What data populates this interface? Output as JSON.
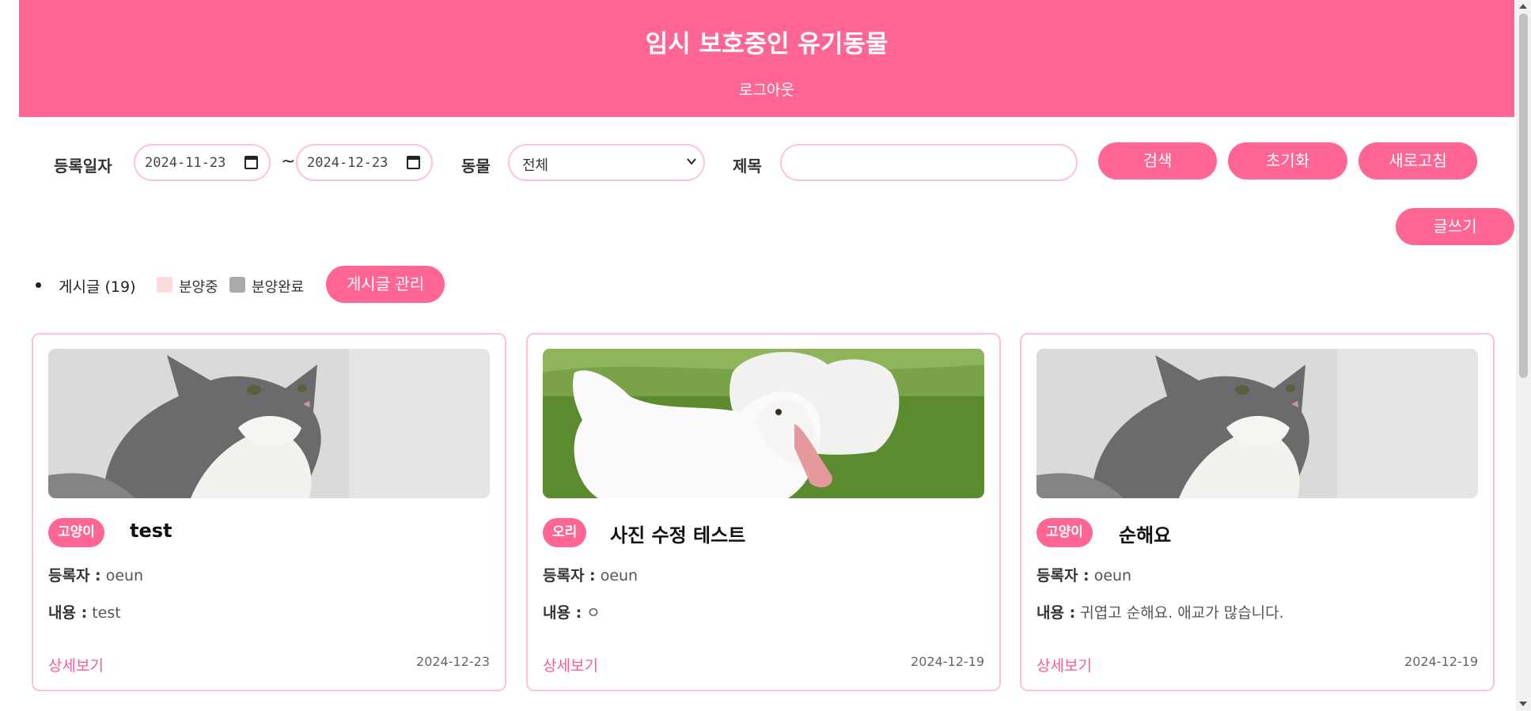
{
  "header": {
    "title": "임시 보호중인 유기동물",
    "logout": "로그아웃"
  },
  "search": {
    "date_label": "등록일자",
    "date_from": "2024-11-23",
    "tilde": "~",
    "date_to": "2024-12-23",
    "animal_label": "동물",
    "animal_selected": "전체",
    "title_label": "제목",
    "title_value": "",
    "search_button": "검색",
    "reset_button": "초기화",
    "refresh_button": "새로고침"
  },
  "write_button": "글쓰기",
  "list": {
    "count_label": "게시글 (19)",
    "legend": [
      {
        "label": "분양중",
        "color": "#fcd9dc"
      },
      {
        "label": "분양완료",
        "color": "#aaaaaa"
      }
    ],
    "manage_button": "게시글 관리"
  },
  "accent_color": "#ff6694",
  "cards": [
    {
      "image": "cat-photo",
      "tag": "고양이",
      "title": "test",
      "author_label": "등록자 :",
      "author": "oeun",
      "content_label": "내용 :",
      "content": "test",
      "detail_link": "상세보기",
      "date": "2024-12-23"
    },
    {
      "image": "duck-photo",
      "tag": "오리",
      "title": "사진 수정 테스트",
      "author_label": "등록자 :",
      "author": "oeun",
      "content_label": "내용 :",
      "content": "ㅇ",
      "detail_link": "상세보기",
      "date": "2024-12-19"
    },
    {
      "image": "cat-photo",
      "tag": "고양이",
      "title": "순해요",
      "author_label": "등록자 :",
      "author": "oeun",
      "content_label": "내용 :",
      "content": "귀엽고 순해요. 애교가 많습니다.",
      "detail_link": "상세보기",
      "date": "2024-12-19"
    }
  ]
}
